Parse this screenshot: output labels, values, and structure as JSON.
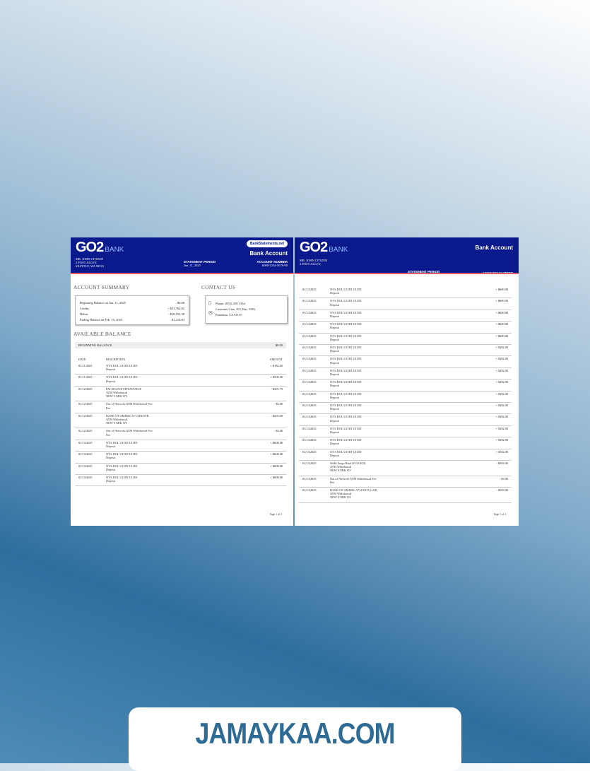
{
  "site": {
    "name": "JAMAYKAA.COM"
  },
  "brand": {
    "logo": "GO2",
    "logo_suffix": "BANK",
    "badge": "BankStatements.net",
    "account_title": "Bank Account",
    "accent": "#0a1a8c",
    "stripe": "#e65b6a"
  },
  "customer": {
    "name": "MR. JOHN CITIZEN",
    "address1": "2 POST ALLEY,",
    "address2": "SEATTLE, WA 98101"
  },
  "page1": {
    "period_label": "STATEMENT PERIOD",
    "period_value": "Jan. 11, 2025",
    "acct_label": "ACCOUNT NUMBER",
    "acct_value": "0000-1234-5678-90",
    "summary": {
      "title": "ACCOUNT SUMMARY",
      "rows": [
        {
          "label": "Beginning Balance on Jan. 11, 2025",
          "value": "$0.00"
        },
        {
          "label": "Credits",
          "value": "+ $15,762.02"
        },
        {
          "label": "Debits",
          "value": "- $18,553.38"
        },
        {
          "label": "Ending Balance on Feb. 10, 2025",
          "value": "$1,210.64"
        }
      ]
    },
    "contact": {
      "title": "CONTACT US",
      "phone_icon": "phone-icon",
      "mail_icon": "mailbox-icon",
      "phone": "Phone: (855) 459-1334",
      "care": "Customer Care, P.O. Box 5100,",
      "city": "Pasadena, CA 91117"
    },
    "available": {
      "title": "AVAILABLE BALANCE",
      "beginning_label": "BEGINNING BALANCE",
      "beginning_value": "$0.00",
      "col_date": "DATE",
      "col_desc": "DESCRIPTION",
      "col_amount": "AMOUNT"
    },
    "transactions": [
      {
        "date": "01/11/2025",
        "line1": "NYS DOL UI DD-UI DD",
        "line2": "Deposit",
        "line3": "",
        "amount": "+ $182.00"
      },
      {
        "date": "01/11/2025",
        "line1": "NYS DOL UI DD-UI DD",
        "line2": "Deposit",
        "line3": "",
        "amount": "+ $500.00"
      },
      {
        "date": "01/12/2025",
        "line1": "PAI ISO2510 8TH AVENUE",
        "line2": "ATM Withdrawal",
        "line3": "NEW YORK NY",
        "amount": "- $201.79"
      },
      {
        "date": "01/12/2025",
        "line1": "Out of Network ATM Withdrawal Fee",
        "line2": "Fee",
        "line3": "",
        "amount": "- $3.00"
      },
      {
        "date": "01/12/2025",
        "line1": "BANK OF AMERICA*14TH STR",
        "line2": "ATM Withdrawal",
        "line3": "NEW YORK NY",
        "amount": "- $203.00"
      },
      {
        "date": "01/12/2025",
        "line1": "Out of Network ATM Withdrawal Fee",
        "line2": "Fee",
        "line3": "",
        "amount": "- $3.00"
      },
      {
        "date": "01/13/2025",
        "line1": "NYS DOL UI DD-UI DD",
        "line2": "Deposit",
        "line3": "",
        "amount": "+ $600.00"
      },
      {
        "date": "01/13/2025",
        "line1": "NYS DOL UI DD-UI DD",
        "line2": "Deposit",
        "line3": "",
        "amount": "+ $600.00"
      },
      {
        "date": "01/13/2025",
        "line1": "NYS DOL UI DD-UI DD",
        "line2": "Deposit",
        "line3": "",
        "amount": "+ $600.00"
      },
      {
        "date": "01/13/2025",
        "line1": "NYS DOL UI DD-UI DD",
        "line2": "Deposit",
        "line3": "",
        "amount": "+ $600.00"
      }
    ],
    "page_label": "Page 1 of 3"
  },
  "page2": {
    "period_label": "STATEMENT PERIOD",
    "acct_label": "ACCOUNT NUMBER",
    "transactions": [
      {
        "date": "01/13/2025",
        "line1": "NYS DOL UI DD-UI DD",
        "line2": "Deposit",
        "line3": "",
        "amount": "+ $600.00"
      },
      {
        "date": "01/13/2025",
        "line1": "NYS DOL UI DD-UI DD",
        "line2": "Deposit",
        "line3": "",
        "amount": "+ $600.00"
      },
      {
        "date": "01/13/2025",
        "line1": "NYS DOL UI DD-UI DD",
        "line2": "Deposit",
        "line3": "",
        "amount": "+ $600.00"
      },
      {
        "date": "01/13/2025",
        "line1": "NYS DOL UI DD-UI DD",
        "line2": "Deposit",
        "line3": "",
        "amount": "+ $600.00"
      },
      {
        "date": "01/13/2025",
        "line1": "NYS DOL UI DD-UI DD",
        "line2": "Deposit",
        "line3": "",
        "amount": "+ $600.00"
      },
      {
        "date": "01/13/2025",
        "line1": "NYS DOL UI DD-UI DD",
        "line2": "Deposit",
        "line3": "",
        "amount": "+ $182.00"
      },
      {
        "date": "01/13/2025",
        "line1": "NYS DOL UI DD-UI DD",
        "line2": "Deposit",
        "line3": "",
        "amount": "+ $182.00"
      },
      {
        "date": "01/13/2025",
        "line1": "NYS DOL UI DD-UI DD",
        "line2": "Deposit",
        "line3": "",
        "amount": "+ $182.00"
      },
      {
        "date": "01/13/2025",
        "line1": "NYS DOL UI DD-UI DD",
        "line2": "Deposit",
        "line3": "",
        "amount": "+ $182.00"
      },
      {
        "date": "01/13/2025",
        "line1": "NYS DOL UI DD-UI DD",
        "line2": "Deposit",
        "line3": "",
        "amount": "+ $182.00"
      },
      {
        "date": "01/13/2025",
        "line1": "NYS DOL UI DD-UI DD",
        "line2": "Deposit",
        "line3": "",
        "amount": "+ $182.00"
      },
      {
        "date": "01/13/2025",
        "line1": "NYS DOL UI DD-UI DD",
        "line2": "Deposit",
        "line3": "",
        "amount": "+ $182.00"
      },
      {
        "date": "01/13/2025",
        "line1": "NYS DOL UI DD-UI DD",
        "line2": "Deposit",
        "line3": "",
        "amount": "+ $182.00"
      },
      {
        "date": "01/13/2025",
        "line1": "NYS DOL UI DD-UI DD",
        "line2": "Deposit",
        "line3": "",
        "amount": "+ $182.00"
      },
      {
        "date": "01/13/2025",
        "line1": "NYS DOL UI DD-UI DD",
        "line2": "Deposit",
        "line3": "",
        "amount": "+ $182.00"
      },
      {
        "date": "01/13/2025",
        "line1": "Wells Fargo Bna145 LENOX",
        "line2": "ATM Withdrawal",
        "line3": "NEW YORK NY",
        "amount": "- $503.00"
      },
      {
        "date": "01/13/2025",
        "line1": "Out of Network ATM Withdrawal Fee",
        "line2": "Fee",
        "line3": "",
        "amount": "- $3.00"
      },
      {
        "date": "01/13/2025",
        "line1": "BANK OF AMERICA*LENOX GAR",
        "line2": "ATM Withdrawal",
        "line3": "NEW YORK NY",
        "amount": "- $503.00"
      }
    ],
    "page_label": "Page 1 of 3"
  }
}
